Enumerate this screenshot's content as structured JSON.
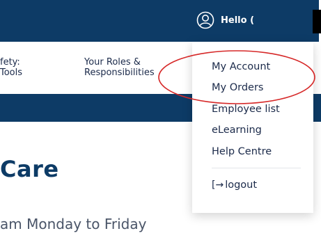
{
  "header": {
    "greeting": "Hello (",
    "user_icon": "user-circle-icon",
    "background": "#0d3b66"
  },
  "subnav": {
    "items": [
      {
        "line1": "fety:",
        "line2": "Tools"
      },
      {
        "line1": "Your Roles &",
        "line2": "Responsibilities"
      }
    ]
  },
  "page": {
    "title": "Care",
    "hours": "am Monday to Friday"
  },
  "account_menu": {
    "items": [
      {
        "label": "My Account"
      },
      {
        "label": "My Orders"
      },
      {
        "label": "Employee list"
      },
      {
        "label": "eLearning"
      },
      {
        "label": "Help Centre"
      }
    ],
    "logout": {
      "icon": "[→",
      "label": "logout"
    }
  },
  "colors": {
    "brand_navy": "#0d3b66",
    "annotation_red": "#d62828"
  }
}
